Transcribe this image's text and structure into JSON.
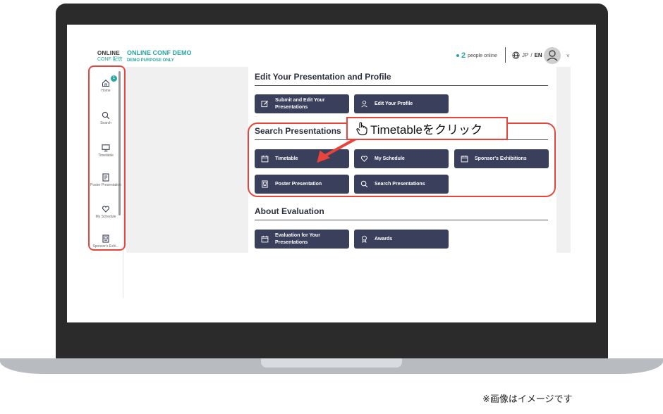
{
  "header": {
    "logo_line1": "ONLINE",
    "logo_line2": "CONF 配信",
    "title": "ONLINE CONF DEMO",
    "subtitle": "DEMO PURPOSE ONLY",
    "online_count": "2",
    "online_label": "people online",
    "lang_jp": "JP",
    "lang_sep": "/",
    "lang_en": "EN"
  },
  "sidebar": {
    "badge": "1",
    "items": [
      {
        "label": "Home",
        "icon": "home-icon"
      },
      {
        "label": "Search",
        "icon": "search-icon"
      },
      {
        "label": "Timetable",
        "icon": "monitor-icon"
      },
      {
        "label": "Poster Presentation",
        "icon": "poster-icon"
      },
      {
        "label": "My Schedule",
        "icon": "heart-icon"
      },
      {
        "label": "Sponsor's Exhi...",
        "icon": "sponsor-icon"
      }
    ]
  },
  "sections": {
    "edit": {
      "title": "Edit Your Presentation and Profile",
      "submit_line1": "Submit and Edit Your",
      "submit_line2": "Presentations",
      "profile": "Edit Your Profile"
    },
    "search": {
      "title": "Search Presentations",
      "timetable": "Timetable",
      "my_schedule": "My Schedule",
      "sponsors": "Sponsor's Exhibitions",
      "poster": "Poster Presentation",
      "search_presentations": "Search Presentations"
    },
    "evaluation": {
      "title": "About Evaluation",
      "eval_line1": "Evaluation for Your",
      "eval_line2": "Presentations",
      "awards": "Awards"
    }
  },
  "annotation": {
    "callout": "Timetableをクリック",
    "highlight_color": "#e8443c"
  },
  "caption": "※画像はイメージです",
  "colors": {
    "accent": "#2aa5a0",
    "button": "#3a3f5c"
  }
}
